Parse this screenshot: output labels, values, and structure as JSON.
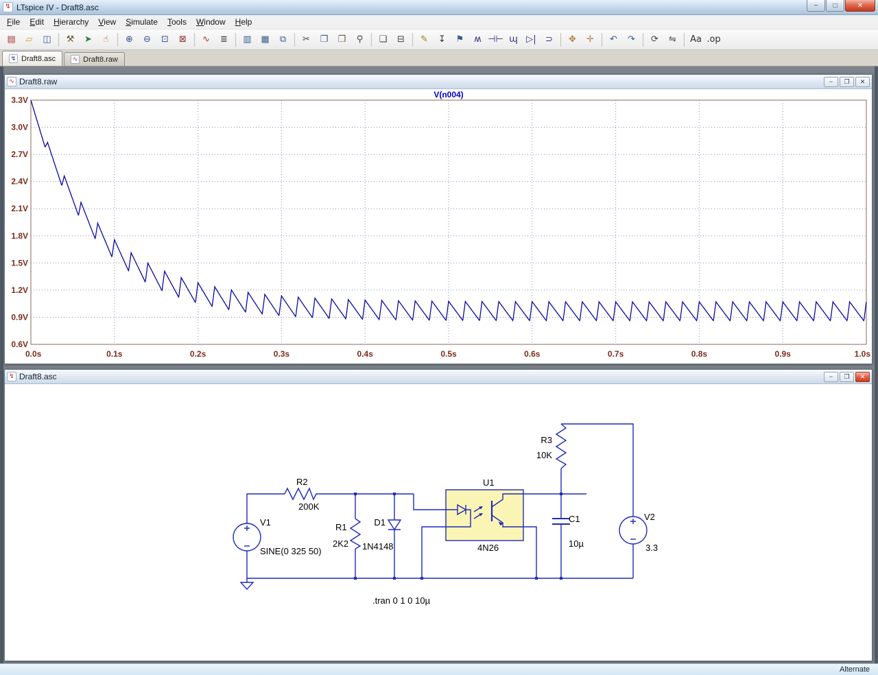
{
  "window": {
    "title": "LTspice IV - Draft8.asc",
    "controls": {
      "minimize": "−",
      "maximize": "□",
      "restore": "❐",
      "close": "✕"
    }
  },
  "icons": {
    "app": "↯",
    "schematic_tab": "↯",
    "waveform_tab": "∿"
  },
  "menubar": {
    "items": [
      "File",
      "Edit",
      "Hierarchy",
      "View",
      "Simulate",
      "Tools",
      "Window",
      "Help"
    ]
  },
  "toolbar": {
    "items": [
      {
        "name": "new-schematic",
        "glyph": "▤",
        "color": "#a83232"
      },
      {
        "name": "open",
        "glyph": "▱",
        "color": "#c89a2a"
      },
      {
        "name": "save",
        "glyph": "◫",
        "color": "#3a5a8c"
      },
      {
        "sep": true
      },
      {
        "name": "control-panel",
        "glyph": "⚒",
        "color": "#6a5a3a"
      },
      {
        "name": "run",
        "glyph": "➤",
        "color": "#2a7a4a"
      },
      {
        "name": "halt",
        "glyph": "☝",
        "color": "#b05a2a"
      },
      {
        "sep": true
      },
      {
        "name": "zoom-area",
        "glyph": "⊕",
        "color": "#30508c"
      },
      {
        "name": "zoom-back",
        "glyph": "⊖",
        "color": "#30508c"
      },
      {
        "name": "zoom-full-extents",
        "glyph": "⊡",
        "color": "#30508c"
      },
      {
        "name": "zoom-undo",
        "glyph": "⊠",
        "color": "#8c3030"
      },
      {
        "sep": true
      },
      {
        "name": "autorange-y-axis",
        "glyph": "∿",
        "color": "#a83232"
      },
      {
        "name": "plot-settings",
        "glyph": "≣",
        "color": "#444444"
      },
      {
        "sep": true
      },
      {
        "name": "tile-vertically",
        "glyph": "▥",
        "color": "#3a5a8c"
      },
      {
        "name": "tile-horizontally",
        "glyph": "▦",
        "color": "#3a5a8c"
      },
      {
        "name": "cascade-windows",
        "glyph": "⧉",
        "color": "#3a5a8c"
      },
      {
        "sep": true
      },
      {
        "name": "cut",
        "glyph": "✂",
        "color": "#444444"
      },
      {
        "name": "copy",
        "glyph": "❐",
        "color": "#3a5a8c"
      },
      {
        "name": "paste",
        "glyph": "❒",
        "color": "#6a5a3a"
      },
      {
        "name": "find",
        "glyph": "⚲",
        "color": "#444444"
      },
      {
        "sep": true
      },
      {
        "name": "print-preview",
        "glyph": "❏",
        "color": "#444444"
      },
      {
        "name": "print",
        "glyph": "⊟",
        "color": "#444444"
      },
      {
        "sep": true
      },
      {
        "name": "wire",
        "glyph": "✎",
        "color": "#9a7a20"
      },
      {
        "name": "ground",
        "glyph": "↧",
        "color": "#303030"
      },
      {
        "name": "net-label",
        "glyph": "⚑",
        "color": "#3a5a8c"
      },
      {
        "name": "resistor",
        "glyph": "ʍ",
        "color": "#303080"
      },
      {
        "name": "capacitor",
        "glyph": "⊣⊢",
        "color": "#303080"
      },
      {
        "name": "inductor",
        "glyph": "ɰ",
        "color": "#303080"
      },
      {
        "name": "diode",
        "glyph": "▷|",
        "color": "#303080"
      },
      {
        "name": "component",
        "glyph": "⊃",
        "color": "#303080"
      },
      {
        "sep": true
      },
      {
        "name": "move",
        "glyph": "✥",
        "color": "#b08040"
      },
      {
        "name": "drag",
        "glyph": "✛",
        "color": "#b08040"
      },
      {
        "sep": true
      },
      {
        "name": "undo",
        "glyph": "↶",
        "color": "#3a5a8c"
      },
      {
        "name": "redo",
        "glyph": "↷",
        "color": "#3a5a8c"
      },
      {
        "sep": true
      },
      {
        "name": "rotate",
        "glyph": "⟳",
        "color": "#444444"
      },
      {
        "name": "mirror",
        "glyph": "⇋",
        "color": "#444444"
      },
      {
        "sep": true
      },
      {
        "name": "text",
        "glyph": "Aa",
        "color": "#303030"
      },
      {
        "name": "spice-directive",
        "glyph": ".op",
        "color": "#303030"
      }
    ]
  },
  "tabs": [
    {
      "label": "Draft8.asc",
      "active": true
    },
    {
      "label": "Draft8.raw",
      "active": false
    }
  ],
  "raw_window": {
    "title": "Draft8.raw"
  },
  "asc_window": {
    "title": "Draft8.asc"
  },
  "statusbar": {
    "text": "Alternate"
  },
  "schematic": {
    "directive": ".tran 0 1 0 10µ",
    "components": {
      "V1": {
        "name": "V1",
        "value": "SINE(0 325 50)"
      },
      "R2": {
        "name": "R2",
        "value": "200K"
      },
      "R1": {
        "name": "R1",
        "value": "2K2"
      },
      "D1": {
        "name": "D1",
        "value": "1N4148"
      },
      "U1": {
        "name": "U1",
        "value": "4N26"
      },
      "R3": {
        "name": "R3",
        "value": "10K"
      },
      "C1": {
        "name": "C1",
        "value": "10µ"
      },
      "V2": {
        "name": "V2",
        "value": "3.3"
      }
    }
  },
  "chart_data": {
    "type": "line",
    "title": "V(n004)",
    "title_color": "#0000cc",
    "axis_color": "#7e2a1a",
    "frame_color": "#8a6a58",
    "grid_color": "#8890b8",
    "grid": "dotted",
    "legend": "none",
    "x_range": [
      0,
      1
    ],
    "y_range": [
      0.6,
      3.3
    ],
    "x_ticks": [
      "0.0s",
      "0.1s",
      "0.2s",
      "0.3s",
      "0.4s",
      "0.5s",
      "0.6s",
      "0.7s",
      "0.8s",
      "0.9s",
      "1.0s"
    ],
    "x_tick_values": [
      0,
      0.1,
      0.2,
      0.3,
      0.4,
      0.5,
      0.6,
      0.7,
      0.8,
      0.9,
      1
    ],
    "y_ticks": [
      "0.6V",
      "0.9V",
      "1.2V",
      "1.5V",
      "1.8V",
      "2.1V",
      "2.4V",
      "2.7V",
      "3.0V",
      "3.3V"
    ],
    "y_tick_values": [
      0.6,
      0.9,
      1.2,
      1.5,
      1.8,
      2.1,
      2.4,
      2.7,
      3.0,
      3.3
    ],
    "series": [
      {
        "name": "V(n004)",
        "color": "#0808a0",
        "description": "50 Hz sawtooth ripple decaying exponentially from 3.3 V toward ~0.86-1.07 V steady state",
        "waveform": {
          "kind": "decaying-sawtooth",
          "period_s": 0.02,
          "rise_fraction": 0.15,
          "peak_initial_v": 3.3,
          "peak_final_v": 1.07,
          "peak_tau_s": 0.085,
          "trough_initial_v": 2.78,
          "trough_final_v": 0.86,
          "trough_tau_s": 0.08
        },
        "envelope_samples": {
          "t_s": [
            0,
            0.05,
            0.1,
            0.15,
            0.2,
            0.25,
            0.3,
            0.35,
            0.4,
            0.45,
            0.5,
            0.55,
            0.6,
            0.65,
            0.7,
            0.75,
            0.8,
            0.85,
            0.9,
            0.95,
            1.0
          ],
          "peak_v": [
            3.3,
            2.31,
            1.76,
            1.45,
            1.28,
            1.19,
            1.14,
            1.11,
            1.09,
            1.08,
            1.08,
            1.07,
            1.07,
            1.07,
            1.07,
            1.07,
            1.07,
            1.07,
            1.07,
            1.07,
            1.07
          ],
          "trough_v": [
            2.78,
            1.89,
            1.41,
            1.15,
            1.02,
            0.94,
            0.91,
            0.88,
            0.87,
            0.86,
            0.86,
            0.86,
            0.86,
            0.86,
            0.86,
            0.86,
            0.86,
            0.86,
            0.86,
            0.86,
            0.86
          ]
        }
      }
    ]
  }
}
